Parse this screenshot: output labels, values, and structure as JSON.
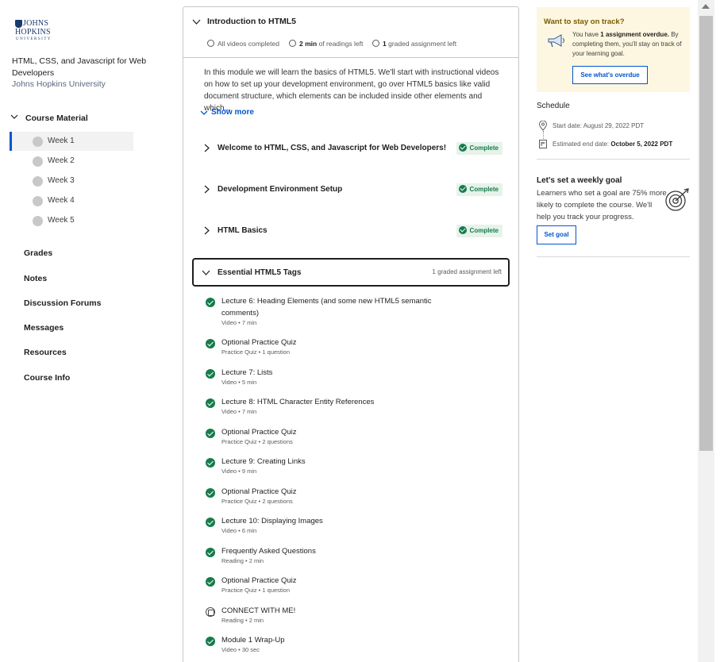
{
  "logo": {
    "line1": "JOHNS",
    "line2": "HOPKINS",
    "line3": "UNIVERSITY"
  },
  "course": {
    "title": "HTML, CSS, and Javascript for Web Developers",
    "university": "Johns Hopkins University"
  },
  "sidebar": {
    "course_material_label": "Course Material",
    "weeks": [
      "Week 1",
      "Week 2",
      "Week 3",
      "Week 4",
      "Week 5"
    ],
    "active_week": "Week 1",
    "nav": [
      "Grades",
      "Notes",
      "Discussion Forums",
      "Messages",
      "Resources",
      "Course Info"
    ]
  },
  "module": {
    "title": "Introduction to HTML5",
    "meta_videos": "All videos completed",
    "meta_readings_bold": "2 min",
    "meta_readings_rest": " of readings left",
    "meta_graded_bold": "1",
    "meta_graded_rest": " graded assignment left",
    "description": "In this module we will learn the basics of HTML5. We'll start with instructional videos on how to set up your development environment, go over HTML5 basics like valid document structure, which elements can be included inside other elements and which...",
    "show_more": "Show more",
    "lessons": [
      {
        "title": "Welcome to HTML, CSS, and Javascript for Web Developers!",
        "status": "Complete"
      },
      {
        "title": "Development Environment Setup",
        "status": "Complete"
      },
      {
        "title": "HTML Basics",
        "status": "Complete"
      }
    ],
    "open_lesson": {
      "title": "Essential HTML5 Tags",
      "graded_left": "1 graded assignment left",
      "items": [
        {
          "title": "Lecture 6: Heading Elements (and some new HTML5 semantic comments)",
          "sub": "Video • 7 min",
          "done": true
        },
        {
          "title": "Optional Practice Quiz",
          "sub": "Practice Quiz • 1 question",
          "done": true
        },
        {
          "title": "Lecture 7: Lists",
          "sub": "Video • 5 min",
          "done": true
        },
        {
          "title": "Lecture 8: HTML Character Entity References",
          "sub": "Video • 7 min",
          "done": true
        },
        {
          "title": "Optional Practice Quiz",
          "sub": "Practice Quiz • 2 questions",
          "done": true
        },
        {
          "title": "Lecture 9: Creating Links",
          "sub": "Video • 9 min",
          "done": true
        },
        {
          "title": "Optional Practice Quiz",
          "sub": "Practice Quiz • 2 questions",
          "done": true
        },
        {
          "title": "Lecture 10: Displaying Images",
          "sub": "Video • 6 min",
          "done": true
        },
        {
          "title": "Frequently Asked Questions",
          "sub": "Reading • 2 min",
          "done": true
        },
        {
          "title": "Optional Practice Quiz",
          "sub": "Practice Quiz • 1 question",
          "done": true
        },
        {
          "title": "CONNECT WITH ME!",
          "sub": "Reading • 2 min",
          "done": false
        },
        {
          "title": "Module 1 Wrap-Up",
          "sub": "Video • 30 sec",
          "done": true
        }
      ]
    }
  },
  "track": {
    "title": "Want to stay on track?",
    "text_pre": "You have ",
    "text_bold": "1 assignment overdue.",
    "text_post": " By completing them, you'll stay on track of your learning goal.",
    "button": "See what's overdue"
  },
  "schedule": {
    "title": "Schedule",
    "start": "Start date: August 29, 2022 PDT",
    "end_label": "Estimated end date: ",
    "end_value": "October 5, 2022 PDT"
  },
  "goal": {
    "title": "Let's set a weekly goal",
    "text": "Learners who set a goal are 75% more likely to complete the course. We'll help you track your progress.",
    "button": "Set goal"
  },
  "colors": {
    "accent": "#0056d2",
    "complete": "#157c4a",
    "track_bg": "#fdf7e1"
  }
}
